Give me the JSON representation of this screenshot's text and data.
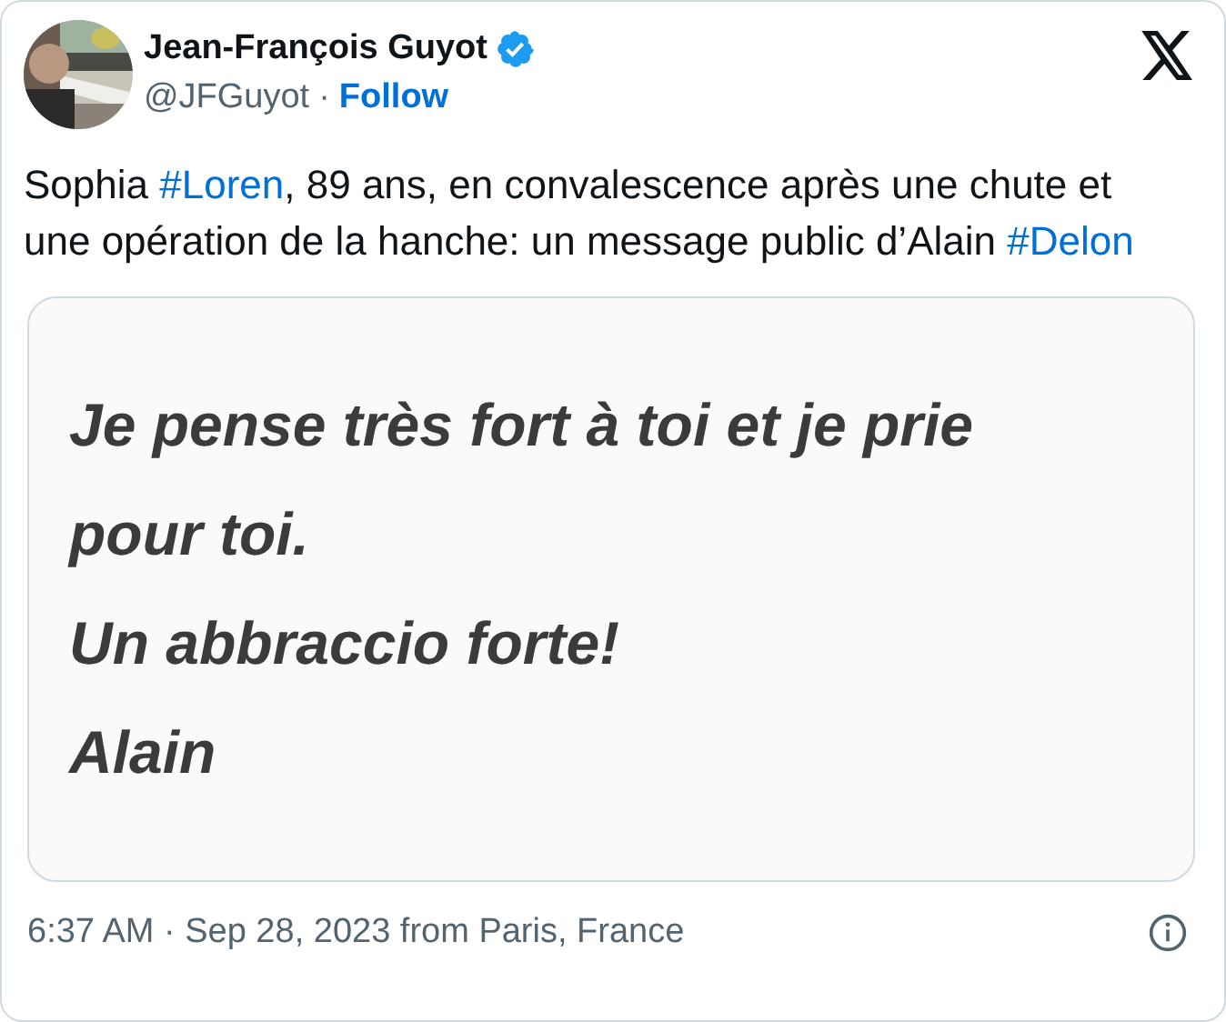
{
  "author": {
    "name": "Jean-François Guyot",
    "verified": true,
    "handle": "@JFGuyot",
    "separator": "·",
    "follow": "Follow"
  },
  "tweet_text": [
    {
      "kind": "text",
      "text": "Sophia "
    },
    {
      "kind": "hashtag",
      "text": "#Loren"
    },
    {
      "kind": "text",
      "text": ", 89 ans, en convalescence après une chute et une opération de la hanche: un message public d’Alain "
    },
    {
      "kind": "hashtag",
      "text": "#Delon"
    }
  ],
  "media": {
    "lines": [
      "Je pense très fort à toi et je prie",
      "pour toi.",
      "Un abbraccio forte!",
      "Alain"
    ]
  },
  "footer": {
    "timestamp": "6:37 AM · Sep 28, 2023 from Paris, France"
  }
}
